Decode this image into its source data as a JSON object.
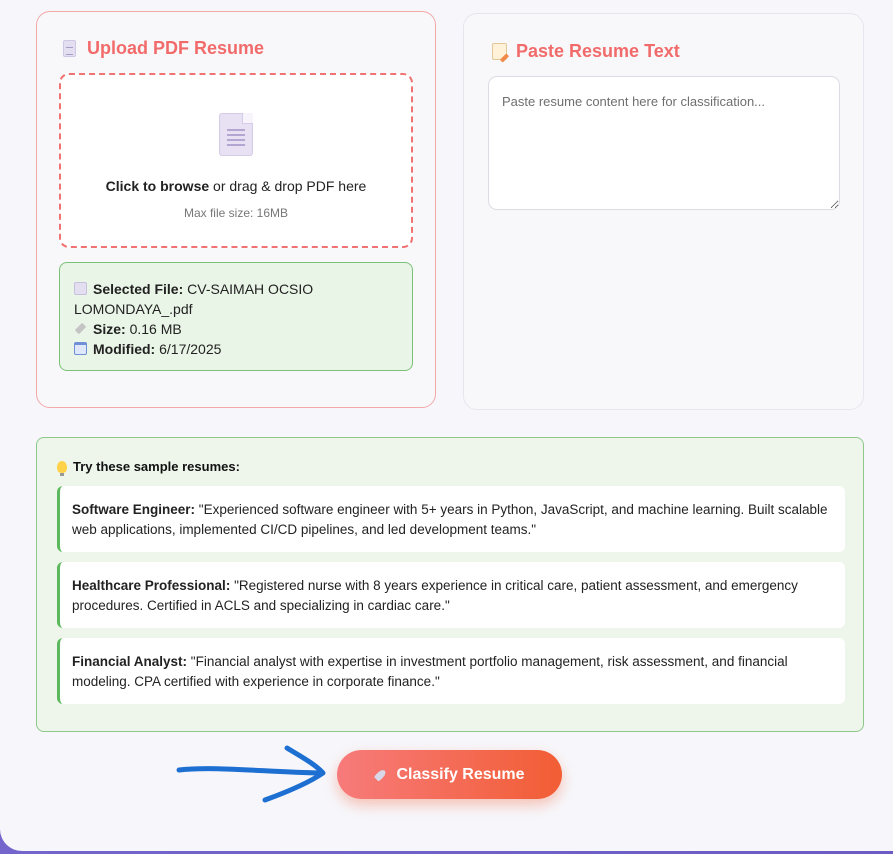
{
  "upload": {
    "title": "Upload PDF Resume",
    "title_icon": "document-icon",
    "drop_bold": "Click to browse",
    "drop_rest": " or drag & drop PDF here",
    "drop_sub": "Max file size: 16MB",
    "file": {
      "selected_label": "Selected File:",
      "selected_value": " CV-SAIMAH OCSIO LOMONDAYA_.pdf",
      "size_label": "Size:",
      "size_value": " 0.16 MB",
      "modified_label": "Modified:",
      "modified_value": " 6/17/2025"
    }
  },
  "paste": {
    "title": "Paste Resume Text",
    "title_icon": "memo-icon",
    "placeholder": "Paste resume content here for classification..."
  },
  "samples": {
    "heading": "Try these sample resumes:",
    "items": [
      {
        "label": "Software Engineer:",
        "text": " \"Experienced software engineer with 5+ years in Python, JavaScript, and machine learning. Built scalable web applications, implemented CI/CD pipelines, and led development teams.\""
      },
      {
        "label": "Healthcare Professional:",
        "text": " \"Registered nurse with 8 years experience in critical care, patient assessment, and emergency procedures. Certified in ACLS and specializing in cardiac care.\""
      },
      {
        "label": "Financial Analyst:",
        "text": " \"Financial analyst with expertise in investment portfolio management, risk assessment, and financial modeling. CPA certified with experience in corporate finance.\""
      }
    ]
  },
  "classify": {
    "label": "Classify Resume",
    "icon": "rocket-icon"
  },
  "colors": {
    "accent": "#f26b6b",
    "success_border": "#7cc07a",
    "button_start": "#f77b7b",
    "button_end": "#f25d34",
    "annotation_arrow": "#1d6fd1"
  }
}
